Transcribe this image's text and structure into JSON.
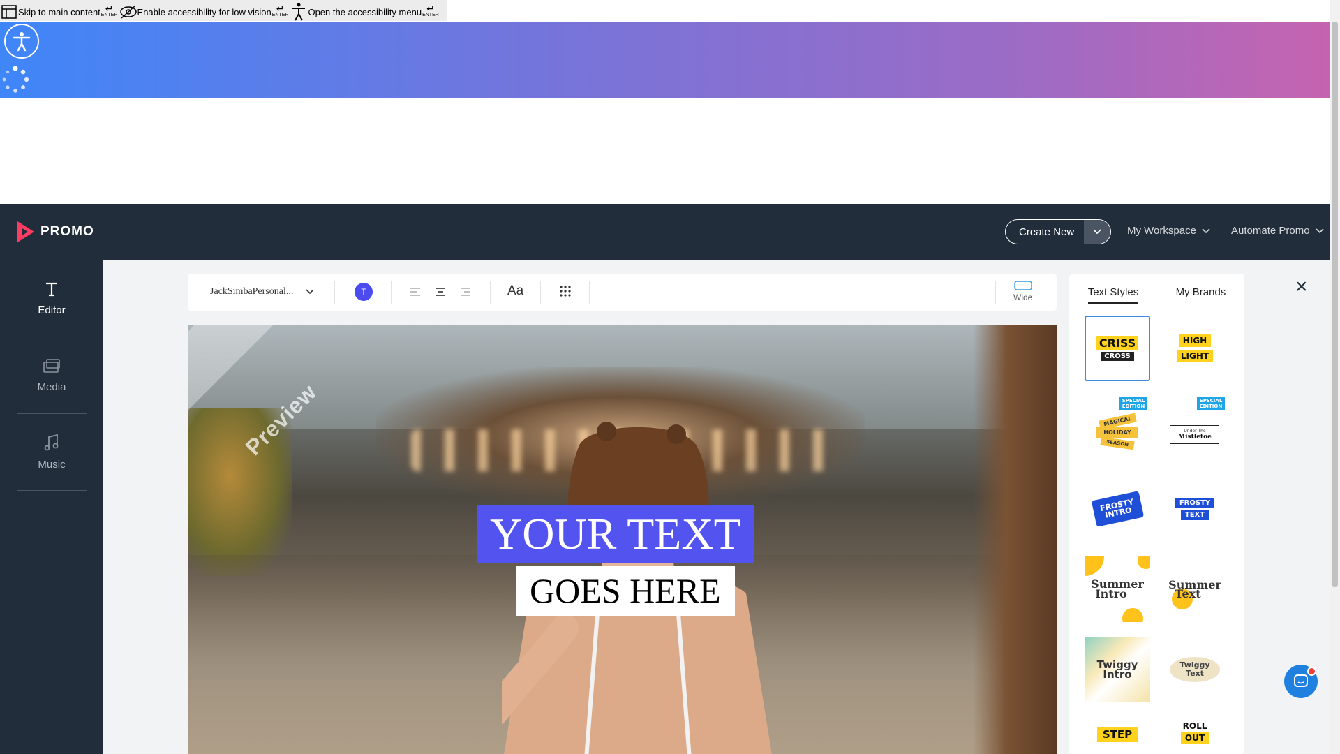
{
  "skip_links": [
    {
      "label": "Skip to main content",
      "key": "ENTER",
      "icon": "layout-icon"
    },
    {
      "label": "Enable accessibility for low vision",
      "key": "ENTER",
      "icon": "eye-off-icon"
    },
    {
      "label": "Open the accessibility menu",
      "key": "ENTER",
      "icon": "accessibility-icon"
    }
  ],
  "header": {
    "logo_text": "PROMO",
    "create_new": "Create New",
    "my_workspace": "My Workspace",
    "automate_promo": "Automate Promo"
  },
  "sidebar": {
    "items": [
      {
        "label": "Editor",
        "icon": "text-icon"
      },
      {
        "label": "Media",
        "icon": "media-icon"
      },
      {
        "label": "Music",
        "icon": "music-icon"
      }
    ]
  },
  "toolbar": {
    "font_name": "JackSimbaPersonal...",
    "color_label": "T",
    "text_size_label": "Aa",
    "ratio_label": "Wide"
  },
  "canvas": {
    "watermark": "Preview",
    "line1": "YOUR TEXT",
    "line2": "GOES HERE"
  },
  "styles_panel": {
    "tabs": [
      "Text Styles",
      "My Brands"
    ],
    "tiles": [
      {
        "name": "criss-cross",
        "lines": [
          "CRISS",
          "CROSS"
        ]
      },
      {
        "name": "high-light",
        "lines": [
          "HIGH",
          "LIGHT"
        ]
      },
      {
        "name": "magical-holiday",
        "lines": [
          "MAGICAL",
          "HOLIDAY",
          "SEASON"
        ],
        "badge": "SPECIAL EDITION"
      },
      {
        "name": "mistletoe",
        "lines": [
          "Under The",
          "Mistletoe"
        ],
        "badge": "SPECIAL EDITION"
      },
      {
        "name": "frosty-intro",
        "lines": [
          "FROSTY",
          "INTRO"
        ]
      },
      {
        "name": "frosty-text",
        "lines": [
          "FROSTY",
          "TEXT"
        ]
      },
      {
        "name": "summer-intro",
        "lines": [
          "Summer",
          "Intro"
        ]
      },
      {
        "name": "summer-text",
        "lines": [
          "Summer",
          "Text"
        ]
      },
      {
        "name": "twiggy-intro",
        "lines": [
          "Twiggy",
          "Intro"
        ]
      },
      {
        "name": "twiggy-text",
        "lines": [
          "Twiggy",
          "Text"
        ]
      },
      {
        "name": "step",
        "lines": [
          "STEP"
        ]
      },
      {
        "name": "roll-out",
        "lines": [
          "ROLL",
          "OUT"
        ]
      }
    ]
  },
  "colors": {
    "nav_bg": "#222d3b",
    "accent_blue": "#5353ef",
    "highlight_yellow": "#ffd21e",
    "selected_border": "#3b8de0"
  }
}
